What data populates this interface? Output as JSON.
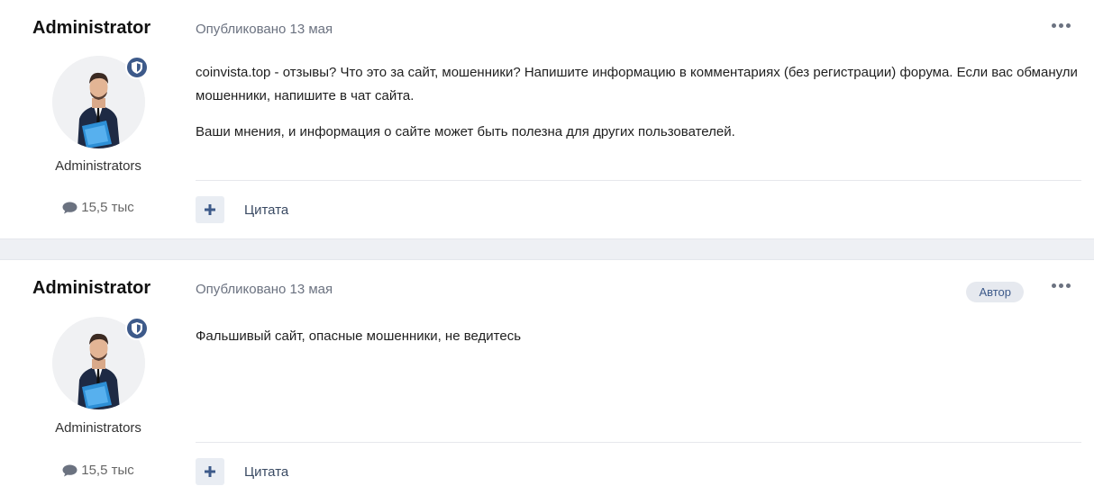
{
  "posts": [
    {
      "author": "Administrator",
      "group": "Administrators",
      "reputation": "15,5 тыс",
      "published": "Опубликовано 13 мая",
      "is_author_badge": false,
      "paragraphs": [
        "coinvista.top - отзывы? Что это за сайт, мошенники? Напишите информацию в комментариях (без регистрации) форума. Если вас обманули мошенники, напишите в чат сайта.",
        "Ваши мнения, и информация о сайте может быть полезна для других пользователей."
      ],
      "quote_label": "Цитата"
    },
    {
      "author": "Administrator",
      "group": "Administrators",
      "reputation": "15,5 тыс",
      "published": "Опубликовано 13 мая",
      "author_badge": "Автор",
      "paragraphs": [
        "Фальшивый сайт, опасные мошенники, не ведитесь"
      ],
      "quote_label": "Цитата"
    }
  ],
  "colors": {
    "accent": "#3d5a8a",
    "background": "#eef0f4",
    "meta_text": "#6b7280"
  },
  "icons": {
    "reputation": "comment-icon",
    "badge": "shield-icon",
    "more": "ellipsis-icon",
    "add": "plus-icon"
  }
}
